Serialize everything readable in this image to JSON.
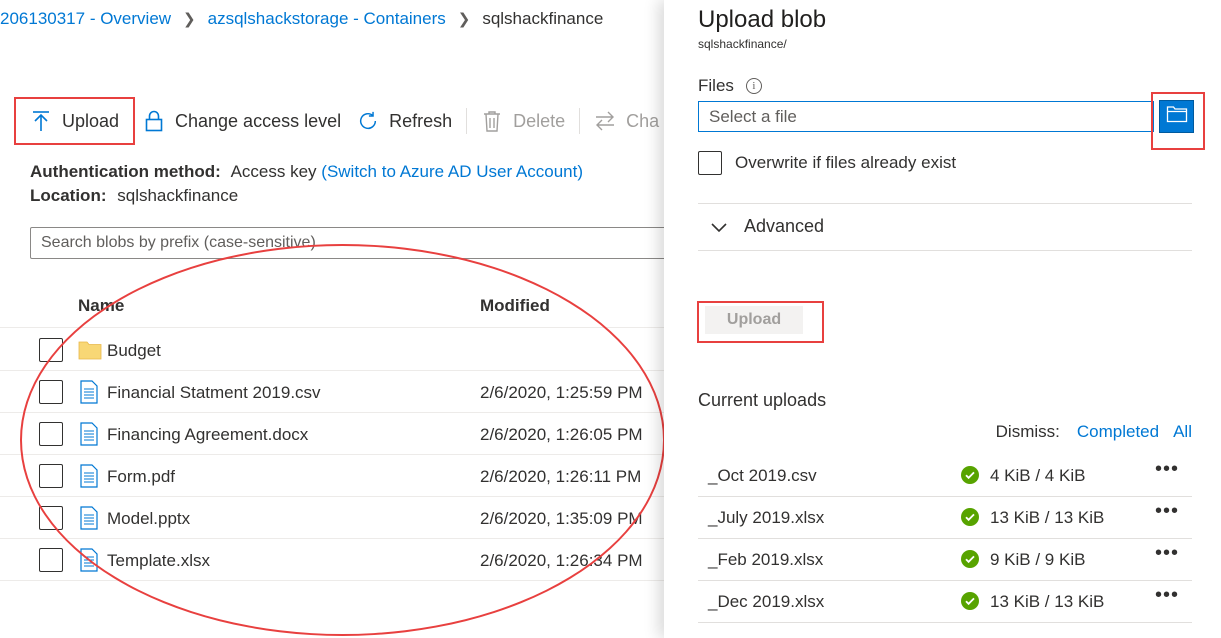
{
  "breadcrumb": {
    "items": [
      "206130317 - Overview",
      "azsqlshackstorage - Containers"
    ],
    "current": "sqlshackfinance"
  },
  "toolbar": {
    "upload": "Upload",
    "change_access": "Change access level",
    "refresh": "Refresh",
    "delete": "Delete",
    "change_tier_partial": "Cha"
  },
  "auth": {
    "label": "Authentication method:",
    "value": "Access key",
    "switch_link": "(Switch to Azure AD User Account)"
  },
  "location": {
    "label": "Location:",
    "value": "sqlshackfinance"
  },
  "search": {
    "placeholder": "Search blobs by prefix (case-sensitive)"
  },
  "grid": {
    "columns": [
      "Name",
      "Modified"
    ],
    "rows": [
      {
        "name": "Budget",
        "modified": "",
        "type": "folder"
      },
      {
        "name": "Financial Statment 2019.csv",
        "modified": "2/6/2020, 1:25:59 PM",
        "type": "file"
      },
      {
        "name": "Financing Agreement.docx",
        "modified": "2/6/2020, 1:26:05 PM",
        "type": "file"
      },
      {
        "name": "Form.pdf",
        "modified": "2/6/2020, 1:26:11 PM",
        "type": "file"
      },
      {
        "name": "Model.pptx",
        "modified": "2/6/2020, 1:35:09 PM",
        "type": "file"
      },
      {
        "name": "Template.xlsx",
        "modified": "2/6/2020, 1:26:34 PM",
        "type": "file"
      }
    ]
  },
  "panel": {
    "title": "Upload blob",
    "subtitle": "sqlshackfinance/",
    "files_label": "Files",
    "info_icon": "i",
    "file_placeholder": "Select a file",
    "overwrite_label": "Overwrite if files already exist",
    "advanced_label": "Advanced",
    "upload_button": "Upload",
    "current_uploads": "Current uploads",
    "dismiss_label": "Dismiss:",
    "dismiss_completed": "Completed",
    "dismiss_all": "All",
    "more_glyph": "•••",
    "uploads": [
      {
        "name": "_Oct 2019.csv",
        "size": "4 KiB / 4 KiB"
      },
      {
        "name": "_July 2019.xlsx",
        "size": "13 KiB / 13 KiB"
      },
      {
        "name": "_Feb 2019.xlsx",
        "size": "9 KiB / 9 KiB"
      },
      {
        "name": "_Dec 2019.xlsx",
        "size": "13 KiB / 13 KiB"
      }
    ]
  },
  "colors": {
    "accent": "#0078d4",
    "highlight": "#e8403f",
    "success": "#57a300",
    "folder": "#f8d775"
  }
}
